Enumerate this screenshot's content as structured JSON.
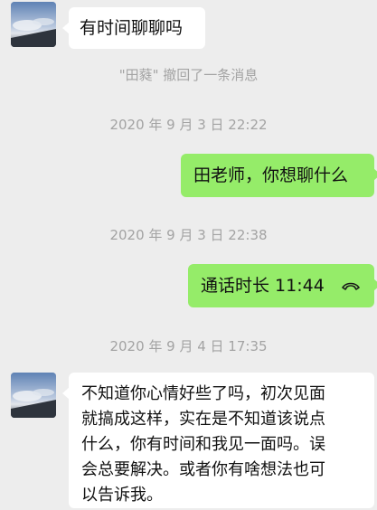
{
  "messages": {
    "m1": "有时间聊聊吗",
    "recall_notice": "\"田蕤\" 撤回了一条消息",
    "ts1": "2020 年 9 月 3 日  22:22",
    "m2": "田老师，你想聊什么",
    "ts2": "2020 年 9 月 3 日  22:38",
    "call_label": "通话时长 11:44",
    "ts3": "2020 年 9 月 4 日  17:35",
    "m3_line1": "不知道你心情好些了吗，初次见面",
    "m3_line2": "就搞成这样，实在是不知道该说点",
    "m3_line3": "什么，你有时间和我见一面吗。误",
    "m3_line4": "会总要解决。或者你有啥想法也可",
    "m3_line5": "以告诉我。"
  },
  "icons": {
    "call": "phone-hangup-icon",
    "avatar": "sky-photo-avatar"
  },
  "colors": {
    "background": "#ededed",
    "bubble_in": "#ffffff",
    "bubble_out": "#95ec69",
    "system_text": "#a3a3a3"
  }
}
